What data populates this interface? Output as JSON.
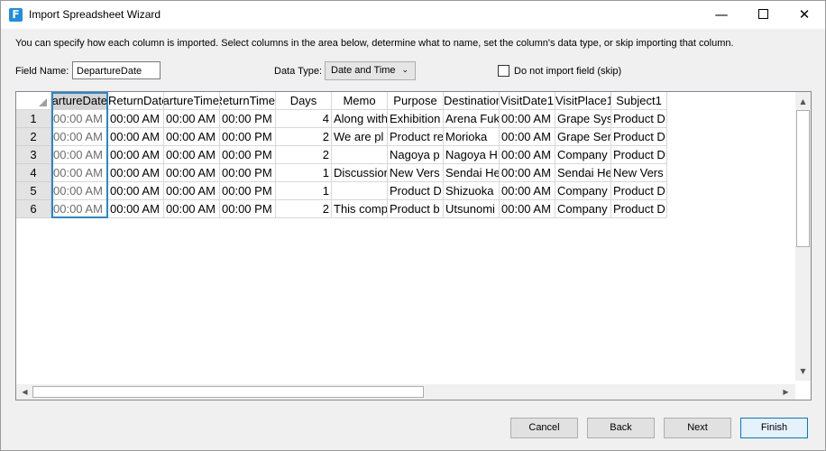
{
  "window": {
    "title": "Import Spreadsheet Wizard",
    "icon_letter": "F",
    "minimize": "—",
    "close": "✕"
  },
  "description": "You can specify how each column is imported. Select columns in the area below, determine what to name, set the column's data type, or skip importing that column.",
  "field_name": {
    "label": "Field Name:",
    "value": "DepartureDate"
  },
  "data_type": {
    "label": "Data Type:",
    "value": "Date and Time",
    "chevron": "⌄"
  },
  "skip": {
    "label": "Do not import field (skip)",
    "checked": false
  },
  "grid": {
    "columns": [
      "DepartureDate",
      "ReturnDate",
      "DepartureTime",
      "ReturnTime",
      "Days",
      "Memo",
      "Purpose",
      "Destination1",
      "VisitDate1",
      "VisitPlace1",
      "Subject1"
    ],
    "rows": [
      {
        "num": "1",
        "cells": [
          "00:00 AM",
          "00:00 AM",
          "00:00 AM",
          "00:00 PM",
          "4",
          "Along with",
          "Exhibition",
          "Arena Fuk",
          "00:00 AM",
          "Grape Sys",
          "Product D"
        ]
      },
      {
        "num": "2",
        "cells": [
          "00:00 AM",
          "00:00 AM",
          "00:00 AM",
          "00:00 PM",
          "2",
          "We are pl",
          "Product re",
          "Morioka",
          "00:00 AM",
          "Grape Ser",
          "Product D"
        ]
      },
      {
        "num": "3",
        "cells": [
          "00:00 AM",
          "00:00 AM",
          "00:00 AM",
          "00:00 PM",
          "2",
          "",
          "Nagoya p",
          "Nagoya H",
          "00:00 AM",
          "Company",
          "Product D"
        ]
      },
      {
        "num": "4",
        "cells": [
          "00:00 AM",
          "00:00 AM",
          "00:00 AM",
          "00:00 PM",
          "1",
          "Discussion",
          "New Vers",
          "Sendai He",
          "00:00 AM",
          "Sendai He",
          "New Vers"
        ]
      },
      {
        "num": "5",
        "cells": [
          "00:00 AM",
          "00:00 AM",
          "00:00 AM",
          "00:00 PM",
          "1",
          "",
          "Product D",
          "Shizuoka",
          "00:00 AM",
          "Company",
          "Product D"
        ]
      },
      {
        "num": "6",
        "cells": [
          "00:00 AM",
          "00:00 AM",
          "00:00 AM",
          "00:00 PM",
          "2",
          "This comp",
          "Product b",
          "Utsunomi",
          "00:00 AM",
          "Company",
          "Product D"
        ]
      }
    ]
  },
  "scroll": {
    "up": "▲",
    "down": "▼",
    "left": "◀",
    "right": "▶"
  },
  "buttons": {
    "cancel": "Cancel",
    "back": "Back",
    "next": "Next",
    "finish": "Finish"
  },
  "colors": {
    "accent": "#0078d7",
    "selection": "#2a88c8",
    "icon": "#1e8fe0"
  }
}
